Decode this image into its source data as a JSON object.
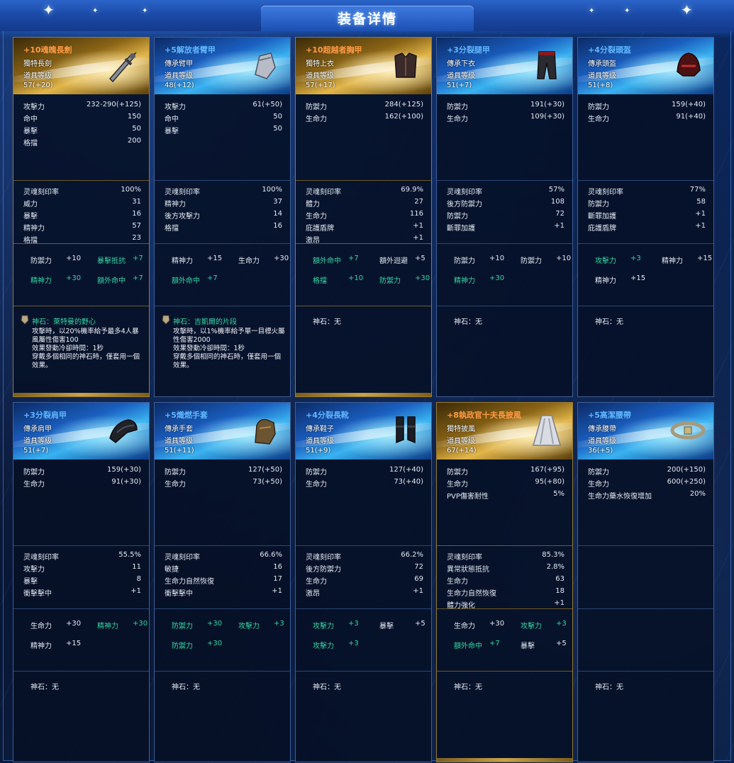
{
  "header": {
    "title": "装备详情"
  },
  "gem_none_text": "神石：无",
  "cards": [
    {
      "name": "+10魂魄長劍",
      "rarity": "gold",
      "type": "獨特長劍",
      "level_label": "道具等级",
      "level": "57(+20)",
      "icon": "sword-icon",
      "stats": [
        [
          "攻擊力",
          "232-290(+125)"
        ],
        [
          "命中",
          "150"
        ],
        [
          "暴擊",
          "50"
        ],
        [
          "格擋",
          "200"
        ]
      ],
      "soul": [
        [
          "灵魂刻印率",
          "100%"
        ],
        [
          "威力",
          "31"
        ],
        [
          "暴擊",
          "16"
        ],
        [
          "精神力",
          "57"
        ],
        [
          "格擋",
          "23"
        ]
      ],
      "bonus": [
        [
          "防禦力",
          "+10",
          "w"
        ],
        [
          "暴擊抵抗",
          "+7",
          "t"
        ],
        [
          "精神力",
          "+30",
          "t"
        ],
        [
          "額外命中",
          "+7",
          "t"
        ]
      ],
      "gem": {
        "title": "神石：萊特曼的野心",
        "desc": "攻擊時，以20%機率給予最多4人暴風屬性傷害100\n效果發動冷卻時間：1秒\n穿戴多個相同的神石時，僅套用一個效果。"
      }
    },
    {
      "name": "+5解放者臂甲",
      "rarity": "blue",
      "type": "傳承臂甲",
      "level_label": "道具等级",
      "level": "48(+12)",
      "icon": "bracer-icon",
      "stats": [
        [
          "攻擊力",
          "61(+50)"
        ],
        [
          "命中",
          "50"
        ],
        [
          "暴擊",
          "50"
        ]
      ],
      "soul": [
        [
          "灵魂刻印率",
          "100%"
        ],
        [
          "精神力",
          "37"
        ],
        [
          "後方攻擊力",
          "14"
        ],
        [
          "格擋",
          "16"
        ]
      ],
      "bonus": [
        [
          "精神力",
          "+15",
          "w"
        ],
        [
          "生命力",
          "+30",
          "w"
        ],
        [
          "額外命中",
          "+7",
          "t"
        ]
      ],
      "gem": {
        "title": "神石：吉凱爾的片段",
        "desc": "攻擊時，以1%機率給予單一目標火屬性傷害2000\n效果發動冷卻時間：1秒\n穿戴多個相同的神石時，僅套用一個效果。"
      }
    },
    {
      "name": "+10超越者胸甲",
      "rarity": "gold",
      "type": "獨特上衣",
      "level_label": "道具等级",
      "level": "57(+17)",
      "icon": "chest-armor-icon",
      "stats": [
        [
          "防禦力",
          "284(+125)"
        ],
        [
          "生命力",
          "162(+100)"
        ]
      ],
      "soul": [
        [
          "灵魂刻印率",
          "69.9%"
        ],
        [
          "體力",
          "27"
        ],
        [
          "生命力",
          "116"
        ],
        [
          "庇護盾牌",
          "+1"
        ],
        [
          "激昂",
          "+1"
        ]
      ],
      "bonus": [
        [
          "額外命中",
          "+7",
          "t"
        ],
        [
          "額外迴避",
          "+5",
          "w"
        ],
        [
          "格擋",
          "+10",
          "t"
        ],
        [
          "防禦力",
          "+30",
          "t"
        ]
      ],
      "gem": null
    },
    {
      "name": "+3分裂腿甲",
      "rarity": "blue",
      "type": "傳承下衣",
      "level_label": "道具等级",
      "level": "51(+7)",
      "icon": "leg-armor-icon",
      "stats": [
        [
          "防禦力",
          "191(+30)"
        ],
        [
          "生命力",
          "109(+30)"
        ]
      ],
      "soul": [
        [
          "灵魂刻印率",
          "57%"
        ],
        [
          "後方防禦力",
          "108"
        ],
        [
          "防禦力",
          "72"
        ],
        [
          "斷罪加護",
          "+1"
        ]
      ],
      "bonus": [
        [
          "防禦力",
          "+10",
          "w"
        ],
        [
          "防禦力",
          "+10",
          "w"
        ],
        [
          "精神力",
          "+30",
          "t"
        ]
      ],
      "gem": null
    },
    {
      "name": "+4分裂頭盔",
      "rarity": "blue",
      "type": "傳承頭盔",
      "level_label": "道具等级",
      "level": "51(+8)",
      "icon": "helmet-icon",
      "stats": [
        [
          "防禦力",
          "159(+40)"
        ],
        [
          "生命力",
          "91(+40)"
        ]
      ],
      "soul": [
        [
          "灵魂刻印率",
          "77%"
        ],
        [
          "防禦力",
          "58"
        ],
        [
          "斷罪加護",
          "+1"
        ],
        [
          "庇護盾牌",
          "+1"
        ]
      ],
      "bonus": [
        [
          "攻擊力",
          "+3",
          "t"
        ],
        [
          "精神力",
          "+15",
          "w"
        ],
        [
          "精神力",
          "+15",
          "w"
        ]
      ],
      "gem": null
    },
    {
      "name": "+3分裂肩甲",
      "rarity": "blue",
      "type": "傳承肩甲",
      "level_label": "道具等级",
      "level": "51(+7)",
      "icon": "shoulder-armor-icon",
      "stats": [
        [
          "防禦力",
          "159(+30)"
        ],
        [
          "生命力",
          "91(+30)"
        ]
      ],
      "soul": [
        [
          "灵魂刻印率",
          "55.5%"
        ],
        [
          "攻擊力",
          "11"
        ],
        [
          "暴擊",
          "8"
        ],
        [
          "衝擊擊中",
          "+1"
        ]
      ],
      "bonus": [
        [
          "生命力",
          "+30",
          "w"
        ],
        [
          "精神力",
          "+30",
          "t"
        ],
        [
          "精神力",
          "+15",
          "w"
        ]
      ],
      "gem": null
    },
    {
      "name": "+5熾燃手套",
      "rarity": "blue",
      "type": "傳承手套",
      "level_label": "道具等级",
      "level": "51(+11)",
      "icon": "glove-icon",
      "stats": [
        [
          "防禦力",
          "127(+50)"
        ],
        [
          "生命力",
          "73(+50)"
        ]
      ],
      "soul": [
        [
          "灵魂刻印率",
          "66.6%"
        ],
        [
          "敏捷",
          "16"
        ],
        [
          "生命力自然恢復",
          "17"
        ],
        [
          "衝擊擊中",
          "+1"
        ]
      ],
      "bonus": [
        [
          "防禦力",
          "+30",
          "t"
        ],
        [
          "攻擊力",
          "+3",
          "t"
        ],
        [
          "防禦力",
          "+30",
          "t"
        ]
      ],
      "gem": null
    },
    {
      "name": "+4分裂長靴",
      "rarity": "blue",
      "type": "傳承鞋子",
      "level_label": "道具等级",
      "level": "51(+9)",
      "icon": "boots-icon",
      "stats": [
        [
          "防禦力",
          "127(+40)"
        ],
        [
          "生命力",
          "73(+40)"
        ]
      ],
      "soul": [
        [
          "灵魂刻印率",
          "66.2%"
        ],
        [
          "後方防禦力",
          "72"
        ],
        [
          "生命力",
          "69"
        ],
        [
          "激昂",
          "+1"
        ]
      ],
      "bonus": [
        [
          "攻擊力",
          "+3",
          "t"
        ],
        [
          "暴擊",
          "+5",
          "w"
        ],
        [
          "攻擊力",
          "+3",
          "t"
        ]
      ],
      "gem": null
    },
    {
      "name": "+8執政官十夫長披風",
      "rarity": "gold",
      "type": "獨特披風",
      "level_label": "道具等级",
      "level": "67(+14)",
      "icon": "cape-icon",
      "stats": [
        [
          "防禦力",
          "167(+95)"
        ],
        [
          "生命力",
          "95(+80)"
        ],
        [
          "PVP傷害耐性",
          "5%"
        ]
      ],
      "soul": [
        [
          "灵魂刻印率",
          "85.3%"
        ],
        [
          "異常狀態抵抗",
          "2.8%"
        ],
        [
          "生命力",
          "63"
        ],
        [
          "生命力自然恢復",
          "18"
        ],
        [
          "體力強化",
          "+1"
        ]
      ],
      "bonus": [
        [
          "生命力",
          "+30",
          "w"
        ],
        [
          "攻擊力",
          "+3",
          "t"
        ],
        [
          "額外命中",
          "+7",
          "t"
        ],
        [
          "暴擊",
          "+5",
          "w"
        ]
      ],
      "gem": null
    },
    {
      "name": "+5高潔腰帶",
      "rarity": "blue",
      "type": "傳承腰帶",
      "level_label": "道具等级",
      "level": "36(+5)",
      "icon": "belt-icon",
      "stats": [
        [
          "防禦力",
          "200(+150)"
        ],
        [
          "生命力",
          "600(+250)"
        ],
        [
          "生命力藥水恢復增加",
          "20%"
        ]
      ],
      "soul": [],
      "bonus": [],
      "gem": null
    }
  ]
}
